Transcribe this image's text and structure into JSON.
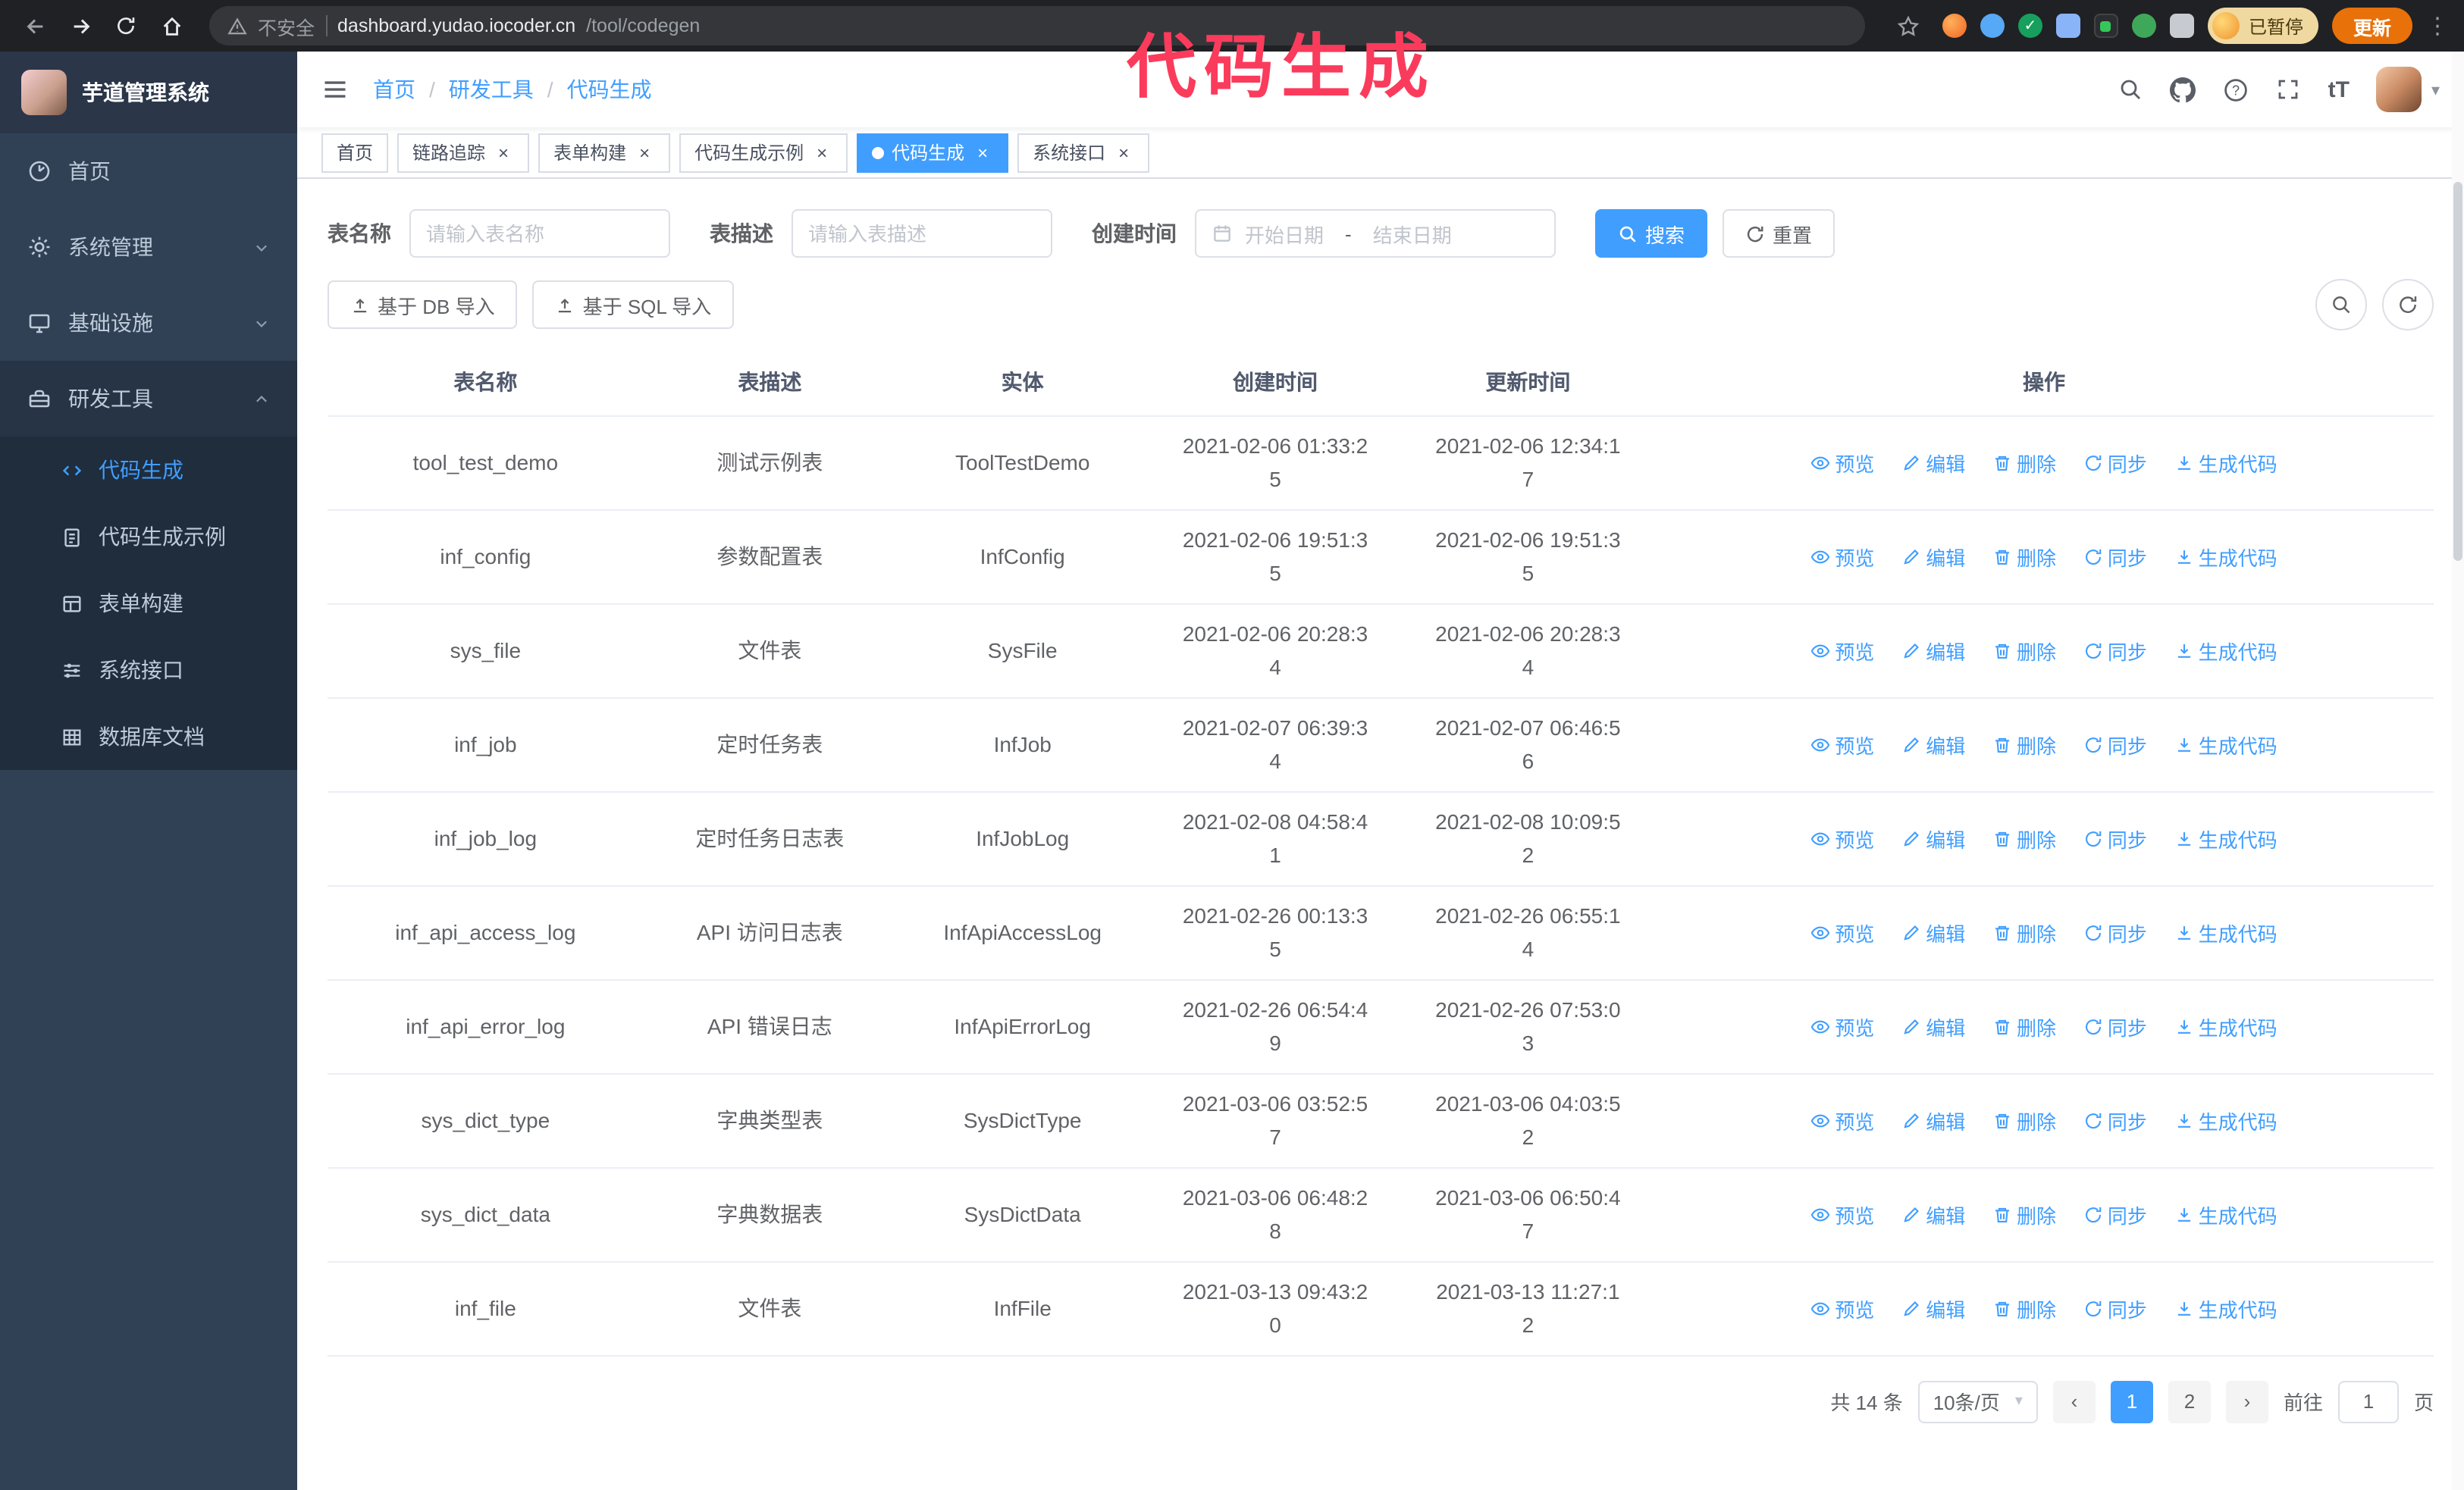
{
  "colors": {
    "accent": "#409EFF",
    "annotation": "#fb3b5c",
    "sidebar_bg": "#304156",
    "submenu_bg": "#1f2d3d"
  },
  "annotation": {
    "text": "代码生成"
  },
  "browser": {
    "security_label": "不安全",
    "url_host": "dashboard.yudao.iocoder.cn",
    "url_path": "/tool/codegen",
    "profile_badge": "已暂停",
    "update_button": "更新"
  },
  "sidebar": {
    "logo_title": "芋道管理系统",
    "items": [
      {
        "label": "首页"
      },
      {
        "label": "系统管理"
      },
      {
        "label": "基础设施"
      },
      {
        "label": "研发工具"
      }
    ],
    "sub_items": [
      {
        "label": "代码生成"
      },
      {
        "label": "代码生成示例"
      },
      {
        "label": "表单构建"
      },
      {
        "label": "系统接口"
      },
      {
        "label": "数据库文档"
      }
    ]
  },
  "header": {
    "breadcrumb": [
      "首页",
      "研发工具",
      "代码生成"
    ],
    "separator": "/"
  },
  "tabs": [
    {
      "label": "首页"
    },
    {
      "label": "链路追踪"
    },
    {
      "label": "表单构建"
    },
    {
      "label": "代码生成示例"
    },
    {
      "label": "代码生成"
    },
    {
      "label": "系统接口"
    }
  ],
  "filters": {
    "table_name_label": "表名称",
    "table_name_placeholder": "请输入表名称",
    "table_desc_label": "表描述",
    "table_desc_placeholder": "请输入表描述",
    "create_time_label": "创建时间",
    "date_start_placeholder": "开始日期",
    "date_separator": "-",
    "date_end_placeholder": "结束日期",
    "search_button": "搜索",
    "reset_button": "重置"
  },
  "toolbar": {
    "import_db_button": "基于 DB 导入",
    "import_sql_button": "基于 SQL 导入"
  },
  "table": {
    "columns": [
      "表名称",
      "表描述",
      "实体",
      "创建时间",
      "更新时间",
      "操作"
    ],
    "actions": [
      "预览",
      "编辑",
      "删除",
      "同步",
      "生成代码"
    ],
    "rows": [
      {
        "name": "tool_test_demo",
        "desc": "测试示例表",
        "entity": "ToolTestDemo",
        "create": "2021-02-06 01:33:25",
        "update": "2021-02-06 12:34:17"
      },
      {
        "name": "inf_config",
        "desc": "参数配置表",
        "entity": "InfConfig",
        "create": "2021-02-06 19:51:35",
        "update": "2021-02-06 19:51:35"
      },
      {
        "name": "sys_file",
        "desc": "文件表",
        "entity": "SysFile",
        "create": "2021-02-06 20:28:34",
        "update": "2021-02-06 20:28:34"
      },
      {
        "name": "inf_job",
        "desc": "定时任务表",
        "entity": "InfJob",
        "create": "2021-02-07 06:39:34",
        "update": "2021-02-07 06:46:56"
      },
      {
        "name": "inf_job_log",
        "desc": "定时任务日志表",
        "entity": "InfJobLog",
        "create": "2021-02-08 04:58:41",
        "update": "2021-02-08 10:09:52"
      },
      {
        "name": "inf_api_access_log",
        "desc": "API 访问日志表",
        "entity": "InfApiAccessLog",
        "create": "2021-02-26 00:13:35",
        "update": "2021-02-26 06:55:14"
      },
      {
        "name": "inf_api_error_log",
        "desc": "API 错误日志",
        "entity": "InfApiErrorLog",
        "create": "2021-02-26 06:54:49",
        "update": "2021-02-26 07:53:03"
      },
      {
        "name": "sys_dict_type",
        "desc": "字典类型表",
        "entity": "SysDictType",
        "create": "2021-03-06 03:52:57",
        "update": "2021-03-06 04:03:52"
      },
      {
        "name": "sys_dict_data",
        "desc": "字典数据表",
        "entity": "SysDictData",
        "create": "2021-03-06 06:48:28",
        "update": "2021-03-06 06:50:47"
      },
      {
        "name": "inf_file",
        "desc": "文件表",
        "entity": "InfFile",
        "create": "2021-03-13 09:43:20",
        "update": "2021-03-13 11:27:12"
      }
    ]
  },
  "pagination": {
    "total": "共 14 条",
    "page_size": "10条/页",
    "pages": [
      "1",
      "2"
    ],
    "goto_label": "前往",
    "goto_value": "1",
    "goto_suffix": "页"
  }
}
